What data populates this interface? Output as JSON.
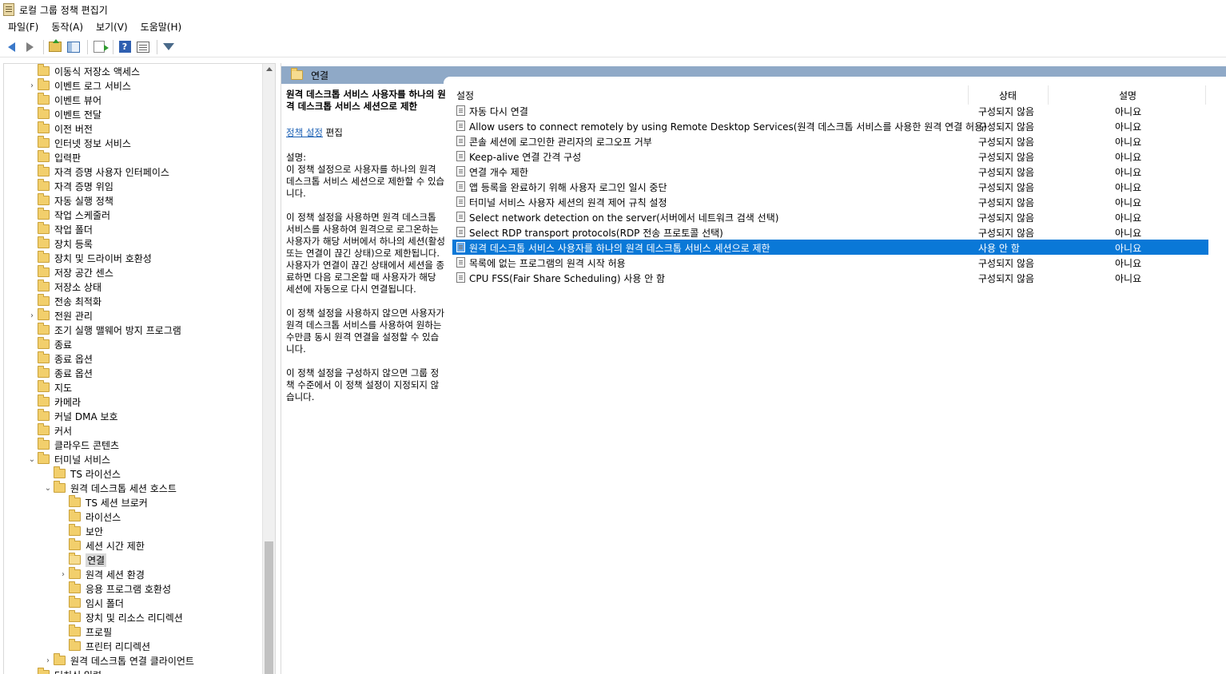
{
  "window": {
    "title": "로컬 그룹 정책 편집기"
  },
  "menu": [
    {
      "label": "파일(F)"
    },
    {
      "label": "동작(A)"
    },
    {
      "label": "보기(V)"
    },
    {
      "label": "도움말(H)"
    }
  ],
  "toolbar": {
    "icons": [
      "back-arrow-icon",
      "forward-arrow-icon",
      "folder-up-icon",
      "show-hide-tree-icon",
      "export-list-icon",
      "help-icon",
      "properties-icon",
      "filter-icon"
    ],
    "help_glyph": "?"
  },
  "tree": {
    "items": [
      {
        "label": "이동식 저장소 액세스",
        "level": 1,
        "expander": ""
      },
      {
        "label": "이벤트 로그 서비스",
        "level": 1,
        "expander": "›"
      },
      {
        "label": "이벤트 뷰어",
        "level": 1,
        "expander": ""
      },
      {
        "label": "이벤트 전달",
        "level": 1,
        "expander": ""
      },
      {
        "label": "이전 버전",
        "level": 1,
        "expander": ""
      },
      {
        "label": "인터넷 정보 서비스",
        "level": 1,
        "expander": ""
      },
      {
        "label": "입력판",
        "level": 1,
        "expander": ""
      },
      {
        "label": "자격 증명 사용자 인터페이스",
        "level": 1,
        "expander": ""
      },
      {
        "label": "자격 증명 위임",
        "level": 1,
        "expander": ""
      },
      {
        "label": "자동 실행 정책",
        "level": 1,
        "expander": ""
      },
      {
        "label": "작업 스케줄러",
        "level": 1,
        "expander": ""
      },
      {
        "label": "작업 폴더",
        "level": 1,
        "expander": ""
      },
      {
        "label": "장치 등록",
        "level": 1,
        "expander": ""
      },
      {
        "label": "장치 및 드라이버 호환성",
        "level": 1,
        "expander": ""
      },
      {
        "label": "저장 공간 센스",
        "level": 1,
        "expander": ""
      },
      {
        "label": "저장소 상태",
        "level": 1,
        "expander": ""
      },
      {
        "label": "전송 최적화",
        "level": 1,
        "expander": ""
      },
      {
        "label": "전원 관리",
        "level": 1,
        "expander": "›"
      },
      {
        "label": "조기 실행 맬웨어 방지 프로그램",
        "level": 1,
        "expander": ""
      },
      {
        "label": "종료",
        "level": 1,
        "expander": ""
      },
      {
        "label": "종료 옵션",
        "level": 1,
        "expander": ""
      },
      {
        "label": "종료 옵션",
        "level": 1,
        "expander": ""
      },
      {
        "label": "지도",
        "level": 1,
        "expander": ""
      },
      {
        "label": "카메라",
        "level": 1,
        "expander": ""
      },
      {
        "label": "커널 DMA 보호",
        "level": 1,
        "expander": ""
      },
      {
        "label": "커서",
        "level": 1,
        "expander": ""
      },
      {
        "label": "클라우드 콘텐츠",
        "level": 1,
        "expander": ""
      },
      {
        "label": "터미널 서비스",
        "level": 1,
        "expander": "⌄"
      },
      {
        "label": "TS 라이선스",
        "level": 2,
        "expander": ""
      },
      {
        "label": "원격 데스크톱 세션 호스트",
        "level": 2,
        "expander": "⌄"
      },
      {
        "label": "TS 세션 브로커",
        "level": 3,
        "expander": ""
      },
      {
        "label": "라이선스",
        "level": 3,
        "expander": ""
      },
      {
        "label": "보안",
        "level": 3,
        "expander": ""
      },
      {
        "label": "세션 시간 제한",
        "level": 3,
        "expander": ""
      },
      {
        "label": "연결",
        "level": 3,
        "expander": "",
        "selected": true
      },
      {
        "label": "원격 세션 환경",
        "level": 3,
        "expander": "›"
      },
      {
        "label": "응용 프로그램 호환성",
        "level": 3,
        "expander": ""
      },
      {
        "label": "임시 폴더",
        "level": 3,
        "expander": ""
      },
      {
        "label": "장치 및 리소스 리디렉션",
        "level": 3,
        "expander": ""
      },
      {
        "label": "프로필",
        "level": 3,
        "expander": ""
      },
      {
        "label": "프린터 리디렉션",
        "level": 3,
        "expander": ""
      },
      {
        "label": "원격 데스크톱 연결 클라이언트",
        "level": 2,
        "expander": "›"
      },
      {
        "label": "터치식 입력",
        "level": 1,
        "expander": ""
      }
    ]
  },
  "right": {
    "header_title": "연결",
    "description": {
      "title": "원격 데스크톱 서비스 사용자를 하나의 원격 데스크톱 서비스 세션으로 제한",
      "link": "정책 설정",
      "link_suffix": " 편집",
      "label": "설명:",
      "paragraphs": [
        "이 정책 설정으로 사용자를 하나의 원격 데스크톱 서비스 세션으로 제한할 수 있습니다.",
        "이 정책 설정을 사용하면 원격 데스크톱 서비스를 사용하여 원격으로 로그온하는 사용자가 해당 서버에서 하나의 세션(활성 또는 연결이 끊긴 상태)으로 제한됩니다. 사용자가 연결이 끊긴 상태에서 세션을 종료하면 다음 로그온할 때 사용자가 해당 세션에 자동으로 다시 연결됩니다.",
        "이 정책 설정을 사용하지 않으면 사용자가 원격 데스크톱 서비스를 사용하여 원하는 수만큼 동시 원격 연결을 설정할 수 있습니다.",
        "이 정책 설정을 구성하지 않으면 그룹 정책 수준에서 이 정책 설정이 지정되지 않습니다."
      ]
    },
    "columns": {
      "setting": "설정",
      "state": "상태",
      "comment": "설명"
    },
    "rows": [
      {
        "name": "자동 다시 연결",
        "state": "구성되지 않음",
        "comment": "아니요"
      },
      {
        "name": "Allow users to connect remotely by using Remote Desktop Services(원격 데스크톱 서비스를 사용한 원격 연결 허용)",
        "state": "구성되지 않음",
        "comment": "아니요"
      },
      {
        "name": "콘솔 세션에 로그인한 관리자의 로그오프 거부",
        "state": "구성되지 않음",
        "comment": "아니요"
      },
      {
        "name": "Keep-alive 연결 간격 구성",
        "state": "구성되지 않음",
        "comment": "아니요"
      },
      {
        "name": "연결 개수 제한",
        "state": "구성되지 않음",
        "comment": "아니요"
      },
      {
        "name": "앱 등록을 완료하기 위해 사용자 로그인 일시 중단",
        "state": "구성되지 않음",
        "comment": "아니요"
      },
      {
        "name": "터미널 서비스 사용자 세션의 원격 제어 규칙 설정",
        "state": "구성되지 않음",
        "comment": "아니요"
      },
      {
        "name": "Select network detection on the server(서버에서 네트워크 검색 선택)",
        "state": "구성되지 않음",
        "comment": "아니요"
      },
      {
        "name": "Select RDP transport protocols(RDP 전송 프로토콜 선택)",
        "state": "구성되지 않음",
        "comment": "아니요"
      },
      {
        "name": "원격 데스크톱 서비스 사용자를 하나의 원격 데스크톱 서비스 세션으로 제한",
        "state": "사용 안 함",
        "comment": "아니요",
        "selected": true
      },
      {
        "name": "목록에 없는 프로그램의 원격 시작 허용",
        "state": "구성되지 않음",
        "comment": "아니요"
      },
      {
        "name": "CPU FSS(Fair Share Scheduling) 사용 안 함",
        "state": "구성되지 않음",
        "comment": "아니요"
      }
    ]
  }
}
